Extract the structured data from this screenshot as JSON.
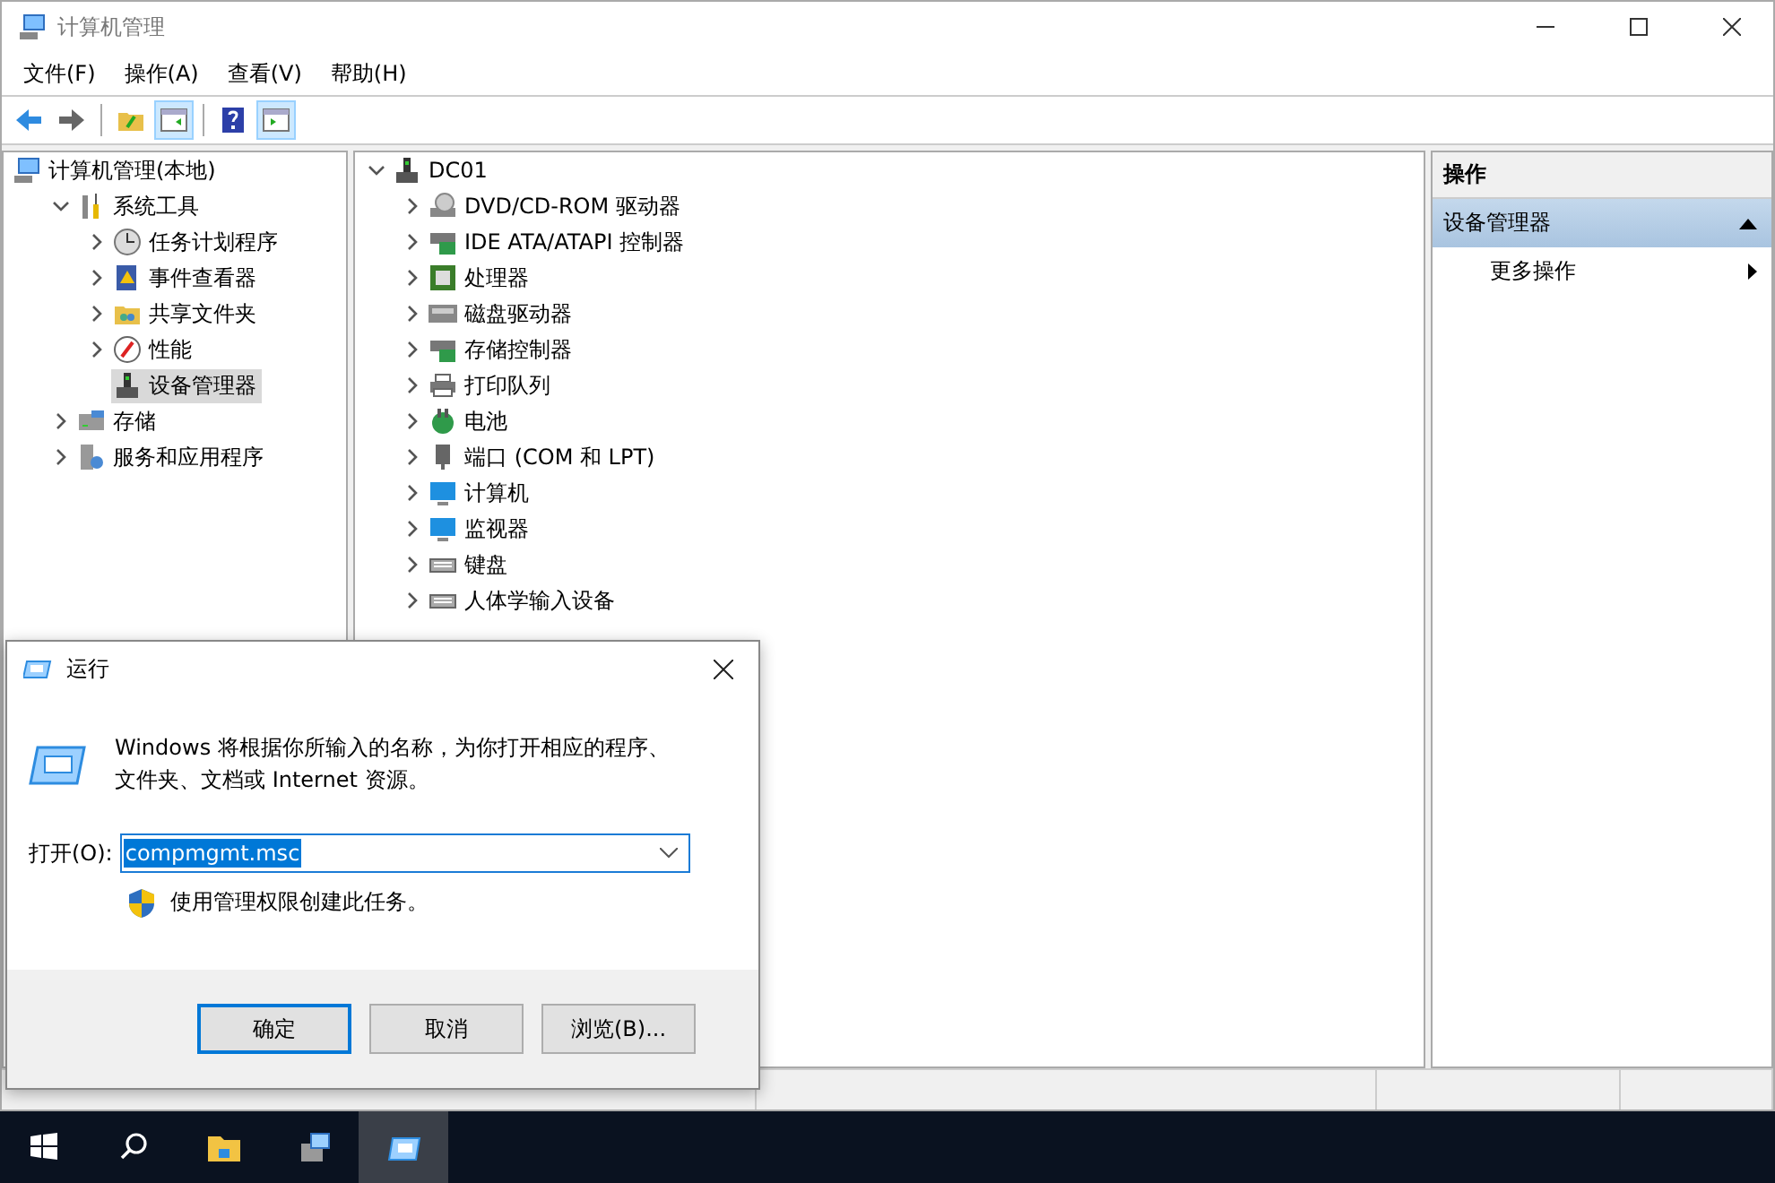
{
  "window": {
    "title": "计算机管理"
  },
  "menu": [
    "文件(F)",
    "操作(A)",
    "查看(V)",
    "帮助(H)"
  ],
  "toolbar": [
    {
      "kind": "back"
    },
    {
      "kind": "forward"
    },
    {
      "kind": "up"
    },
    {
      "kind": "tree",
      "pressed": true
    },
    {
      "kind": "help"
    },
    {
      "kind": "actionpane",
      "pressed": true
    }
  ],
  "tree": [
    {
      "label": "计算机管理(本地)",
      "selected": false,
      "children": [
        {
          "label": "系统工具",
          "expanded": true,
          "selected": false,
          "children": [
            {
              "label": "任务计划程序",
              "expanded": false,
              "selected": false
            },
            {
              "label": "事件查看器",
              "expanded": false,
              "selected": false
            },
            {
              "label": "共享文件夹",
              "expanded": false,
              "selected": false
            },
            {
              "label": "性能",
              "expanded": false,
              "selected": false
            },
            {
              "label": "设备管理器",
              "selected": true
            }
          ]
        },
        {
          "label": "存储",
          "expanded": false,
          "selected": false
        },
        {
          "label": "服务和应用程序",
          "expanded": false,
          "selected": false
        }
      ]
    }
  ],
  "devices": [
    {
      "label": "DC01",
      "expanded": true,
      "children": [
        {
          "label": "DVD/CD-ROM 驱动器",
          "expanded": false
        },
        {
          "label": "IDE ATA/ATAPI 控制器",
          "expanded": false
        },
        {
          "label": "处理器",
          "expanded": false
        },
        {
          "label": "磁盘驱动器",
          "expanded": false
        },
        {
          "label": "存储控制器",
          "expanded": false
        },
        {
          "label": "打印队列",
          "expanded": false
        },
        {
          "label": "电池",
          "expanded": false
        },
        {
          "label": "端口 (COM 和 LPT)",
          "expanded": false
        },
        {
          "label": "计算机",
          "expanded": false
        },
        {
          "label": "监视器",
          "expanded": false
        },
        {
          "label": "键盘",
          "expanded": false
        },
        {
          "label": "人体学输入设备",
          "expanded": false
        }
      ]
    }
  ],
  "actions": {
    "header": "操作",
    "section": {
      "label": "设备管理器",
      "expanded": true
    },
    "items": [
      "更多操作"
    ]
  },
  "run_dialog": {
    "title": "运行",
    "description": "Windows 将根据你所输入的名称，为你打开相应的程序、文件夹、文档或 Internet 资源。",
    "open_label": "打开(O):",
    "value": "compmgmt.msc",
    "admin_note": "使用管理权限创建此任务。",
    "buttons": [
      {
        "label": "确定",
        "default": true
      },
      {
        "label": "取消",
        "default": false
      },
      {
        "label": "浏览(B)...",
        "default": false
      }
    ]
  },
  "taskbar": [
    {
      "kind": "start"
    },
    {
      "kind": "search"
    },
    {
      "kind": "explorer",
      "selected": false
    },
    {
      "kind": "server",
      "selected": false
    },
    {
      "kind": "run",
      "selected": true
    }
  ]
}
